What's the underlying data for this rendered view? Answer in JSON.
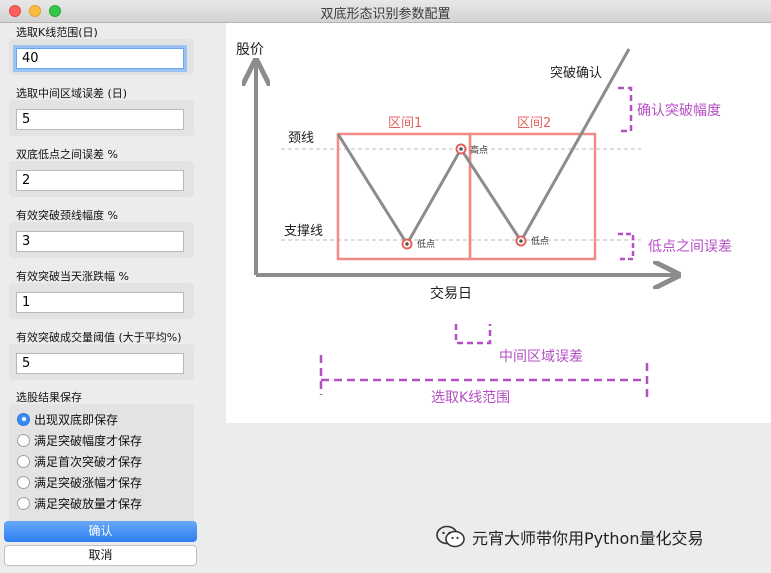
{
  "window": {
    "title": "双底形态识别参数配置"
  },
  "fields": [
    {
      "label": "选取K线范围(日)",
      "value": "40"
    },
    {
      "label": "选取中间区域误差 (日)",
      "value": "5"
    },
    {
      "label": "双底低点之间误差 %",
      "value": "2"
    },
    {
      "label": "有效突破颈线幅度 %",
      "value": "3"
    },
    {
      "label": "有效突破当天涨跌幅 %",
      "value": "1"
    },
    {
      "label": "有效突破成交量阈值 (大于平均%)",
      "value": "5"
    }
  ],
  "save": {
    "label": "选股结果保存",
    "options": [
      {
        "label": "出现双底即保存",
        "checked": true
      },
      {
        "label": "满足突破幅度才保存",
        "checked": false
      },
      {
        "label": "满足首次突破才保存",
        "checked": false
      },
      {
        "label": "满足突破涨幅才保存",
        "checked": false
      },
      {
        "label": "满足突破放量才保存",
        "checked": false
      }
    ]
  },
  "buttons": {
    "ok": "确认",
    "cancel": "取消"
  },
  "diagram": {
    "ylabel": "股价",
    "xlabel": "交易日",
    "neckline": "颈线",
    "support": "支撑线",
    "zone1": "区间1",
    "zone2": "区间2",
    "breakout": "突破确认",
    "high": "高点",
    "low1": "低点",
    "low2": "低点",
    "breakout_margin": "确认突破幅度",
    "low_error": "低点之间误差",
    "middle_error": "中间区域误差",
    "kline_range": "选取K线范围",
    "colors": {
      "zone": "#f08b88",
      "annotation": "#b54fc4",
      "line": "#8c8c8c"
    }
  },
  "watermark": {
    "text": "元宵大师带你用Python量化交易",
    "icon": "wechat-icon"
  }
}
